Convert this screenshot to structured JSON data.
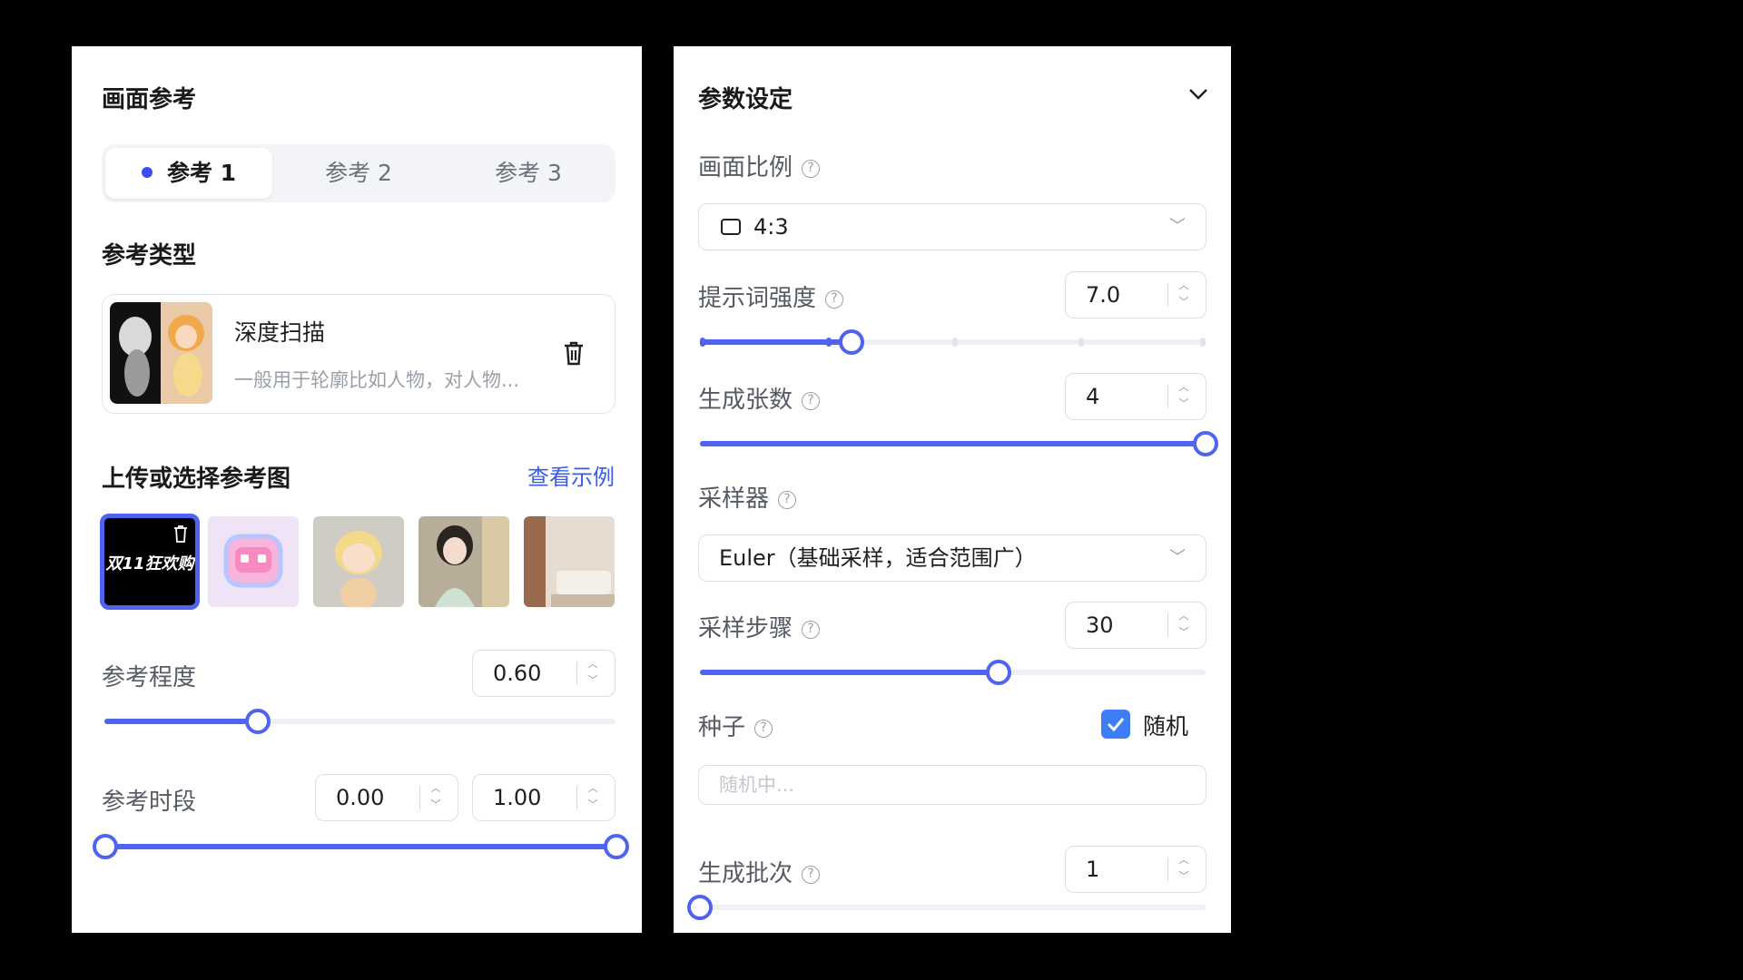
{
  "left": {
    "title": "画面参考",
    "tabs": [
      {
        "label": "参考 1",
        "active": true
      },
      {
        "label": "参考 2",
        "active": false
      },
      {
        "label": "参考 3",
        "active": false
      }
    ],
    "type_section_title": "参考类型",
    "type_card": {
      "name": "深度扫描",
      "desc": "一般用于轮廓比如人物，对人物..."
    },
    "upload_title": "上传或选择参考图",
    "example_link": "查看示例",
    "first_thumb_text": "双11狂欢购",
    "strength": {
      "label": "参考程度",
      "value": "0.60",
      "fraction": 0.3
    },
    "period": {
      "label": "参考时段",
      "start": "0.00",
      "end": "1.00",
      "start_fraction": 0.0,
      "end_fraction": 1.0
    }
  },
  "right": {
    "title": "参数设定",
    "chevron": "chevron-down-icon",
    "ratio": {
      "label": "画面比例",
      "value": "4:3"
    },
    "prompt_strength": {
      "label": "提示词强度",
      "value": "7.0",
      "fraction": 0.3
    },
    "count": {
      "label": "生成张数",
      "value": "4",
      "fraction": 1.0
    },
    "sampler": {
      "label": "采样器",
      "value": "Euler（基础采样，适合范围广）"
    },
    "steps": {
      "label": "采样步骤",
      "value": "30",
      "fraction": 0.59
    },
    "seed": {
      "label": "种子",
      "random_label": "随机",
      "random_checked": true,
      "placeholder": "随机中..."
    },
    "batch": {
      "label": "生成批次",
      "value": "1",
      "fraction": 0.0
    }
  },
  "colors": {
    "accent": "#4f63ef",
    "tab_dot": "#3c4cf0",
    "link": "#3b5ce8",
    "checkbox": "#3d7df5"
  }
}
